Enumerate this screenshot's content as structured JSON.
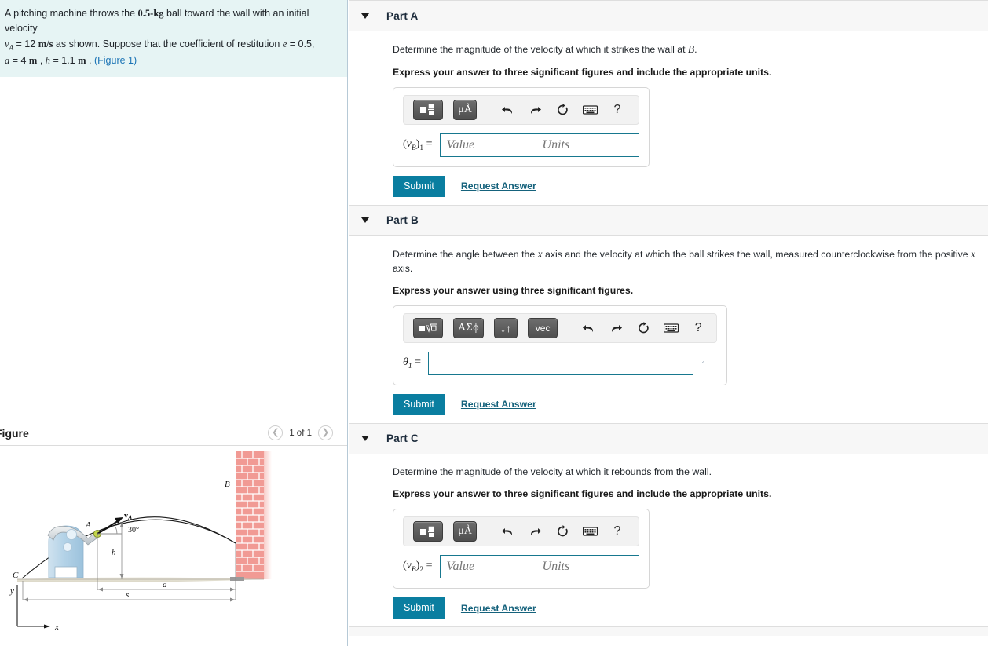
{
  "problem": {
    "line1_a": "A pitching machine throws the ",
    "mass": "0.5-kg",
    "line1_b": " ball toward the wall with an initial velocity",
    "v_sym": "v",
    "v_sub": "A",
    "v_eq": " = 12 ",
    "v_units": "m/s",
    "line2_b": " as shown. Suppose that the coefficient of restitution ",
    "e_sym": "e",
    "e_val": " = 0.5,",
    "a_sym": "a",
    "a_val": " = 4 ",
    "a_units": "m",
    "sep1": " , ",
    "h_sym": "h",
    "h_val": " = 1.1 ",
    "h_units": "m",
    "sep2": " . ",
    "figure_link": "(Figure 1)"
  },
  "figure": {
    "title": "Figure",
    "prev_icon": "chevron-left",
    "next_icon": "chevron-right",
    "counter": "1 of 1",
    "labels": {
      "A": "A",
      "B": "B",
      "C": "C",
      "vA": "v",
      "vA_sub": "A",
      "angle": "30°",
      "h": "h",
      "a": "a",
      "s": "s",
      "x": "x",
      "y": "y"
    },
    "colors": {
      "brick": "#ef9a96",
      "brick_line": "#ffffff",
      "machine_body": "#b9d4e8",
      "machine_arm": "#d9dde0",
      "ball": "#c3d64a",
      "ground": "#e3e0d2",
      "curve": "#1a1a1a"
    }
  },
  "toolbar_common": {
    "undo_icon": "undo-arrow-icon",
    "redo_icon": "redo-arrow-icon",
    "reset_icon": "reset-circular-arrow-icon",
    "keyboard_icon": "keyboard-icon",
    "help_icon": "help-question-icon",
    "help_label": "?"
  },
  "parts": [
    {
      "id": "A",
      "title": "Part A",
      "caret": "caret-down-icon",
      "question": "Determine the magnitude of the velocity at which it strikes the wall at ",
      "question_var": "B",
      "question_tail": ".",
      "instruction": "Express your answer to three significant figures and include the appropriate units.",
      "toolbar_buttons": [
        {
          "name": "template-button",
          "glyph": "template"
        },
        {
          "name": "units-button",
          "glyph": "μÅ"
        }
      ],
      "label_open": "(",
      "label_v": "v",
      "label_sub": "B",
      "label_close": ")",
      "label_index": "1",
      "label_eq": " =",
      "value_placeholder": "Value",
      "units_placeholder": "Units",
      "value": "",
      "units": "",
      "submit_label": "Submit",
      "request_label": "Request Answer"
    },
    {
      "id": "B",
      "title": "Part B",
      "caret": "caret-down-icon",
      "question_pre": "Determine the angle between the ",
      "question_var1": "x",
      "question_mid": " axis and the velocity at which the ball strikes the wall, measured counterclockwise from the positive ",
      "question_var2": "x",
      "question_post": " axis.",
      "instruction": "Express your answer using three significant figures.",
      "toolbar_buttons": [
        {
          "name": "template-radical-button",
          "glyph": "radical"
        },
        {
          "name": "greek-symbols-button",
          "glyph": "ΑΣϕ"
        },
        {
          "name": "arrows-button",
          "glyph": "↓↑"
        },
        {
          "name": "vector-button",
          "glyph": "vec"
        }
      ],
      "label_theta": "θ",
      "label_sub": "1",
      "label_eq": " =",
      "value": "",
      "degree_symbol": "◦",
      "submit_label": "Submit",
      "request_label": "Request Answer"
    },
    {
      "id": "C",
      "title": "Part C",
      "caret": "caret-down-icon",
      "question": "Determine the magnitude of the velocity at which it rebounds from the wall.",
      "instruction": "Express your answer to three significant figures and include the appropriate units.",
      "toolbar_buttons": [
        {
          "name": "template-button",
          "glyph": "template"
        },
        {
          "name": "units-button",
          "glyph": "μÅ"
        }
      ],
      "label_open": "(",
      "label_v": "v",
      "label_sub": "B",
      "label_close": ")",
      "label_index": "2",
      "label_eq": " =",
      "value_placeholder": "Value",
      "units_placeholder": "Units",
      "value": "",
      "units": "",
      "submit_label": "Submit",
      "request_label": "Request Answer"
    }
  ],
  "colors": {
    "accent": "#0a7ea0",
    "link": "#15627c",
    "input_border": "#17788f",
    "panel_bg": "#e6f4f4",
    "header_bg": "#f7f7f7"
  }
}
